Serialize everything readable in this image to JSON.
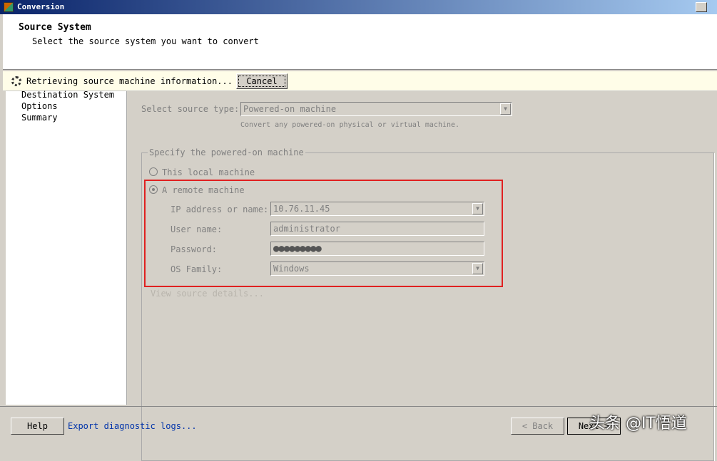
{
  "window": {
    "title": "Conversion"
  },
  "header": {
    "title": "Source System",
    "subtitle": "Select the source system you want to convert"
  },
  "notice": {
    "text": "Retrieving source machine information...",
    "cancel_label": "Cancel"
  },
  "sidebar": {
    "items": [
      "Destination System",
      "Options",
      "Summary"
    ]
  },
  "main": {
    "source_type_label": "Select source type:",
    "source_type_value": "Powered-on machine",
    "source_type_hint": "Convert any powered-on physical or virtual machine.",
    "group_label": "Specify the powered-on machine",
    "radio_local": "This local machine",
    "radio_remote": "A remote machine",
    "remote_selected": true,
    "ip_label": "IP address or name:",
    "ip_value": "10.76.11.45",
    "user_label": "User name:",
    "user_value": "administrator",
    "password_label": "Password:",
    "password_value": "●●●●●●●●●",
    "os_label": "OS Family:",
    "os_value": "Windows",
    "details_link": "View source details..."
  },
  "footer": {
    "help": "Help",
    "export": "Export diagnostic logs...",
    "back": "< Back",
    "next": "Next >"
  },
  "watermark": "头条 @IT悟道",
  "colors": {
    "highlight_box": "#e02020",
    "title_bar": "#0a246a"
  }
}
